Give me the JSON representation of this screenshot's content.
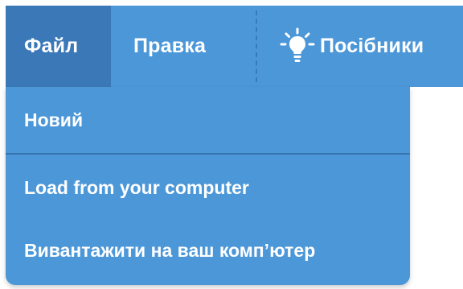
{
  "menubar": {
    "file_label": "Файл",
    "edit_label": "Правка",
    "tutorials_label": "Посібники",
    "tutorials_icon": "lightbulb-icon"
  },
  "file_menu": {
    "items": [
      {
        "label": "Новий"
      },
      {
        "label": "Load from your computer"
      },
      {
        "label": "Вивантажити на ваш комп’ютер"
      }
    ]
  },
  "colors": {
    "menu_bg": "#4c97d8",
    "active_tab_bg": "#3b78b7",
    "text": "#ffffff"
  }
}
